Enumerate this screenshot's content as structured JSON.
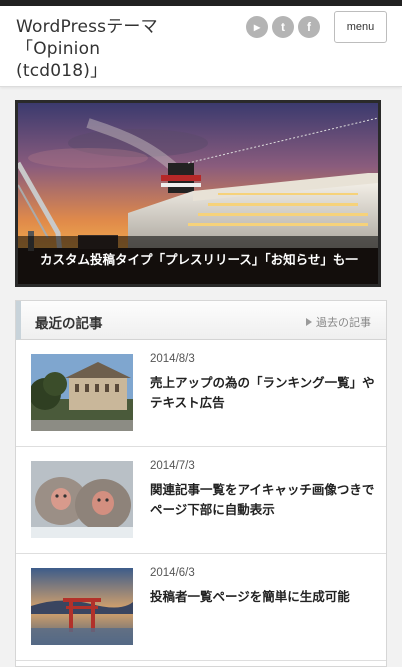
{
  "header": {
    "site_title": "WordPressテーマ「Opinion (tcd018)」",
    "menu_label": "menu",
    "social": [
      {
        "name": "rss-icon",
        "glyph": "▸"
      },
      {
        "name": "twitter-icon",
        "glyph": "t"
      },
      {
        "name": "facebook-icon",
        "glyph": "f"
      }
    ]
  },
  "slider": {
    "caption": "カスタム投稿タイプ「プレスリリース」「お知らせ」も一"
  },
  "recent": {
    "title": "最近の記事",
    "archive_label": "過去の記事",
    "posts": [
      {
        "date": "2014/8/3",
        "title": "売上アップの為の「ランキング一覧」やテキスト広告"
      },
      {
        "date": "2014/7/3",
        "title": "関連記事一覧をアイキャッチ画像つきでページ下部に自動表示"
      },
      {
        "date": "2014/6/3",
        "title": "投稿者一覧ページを簡単に生成可能"
      }
    ]
  },
  "colors": {
    "accent_bar": "#c8d3da",
    "social_icon_bg": "#b4b4b4",
    "topbar": "#222222"
  }
}
